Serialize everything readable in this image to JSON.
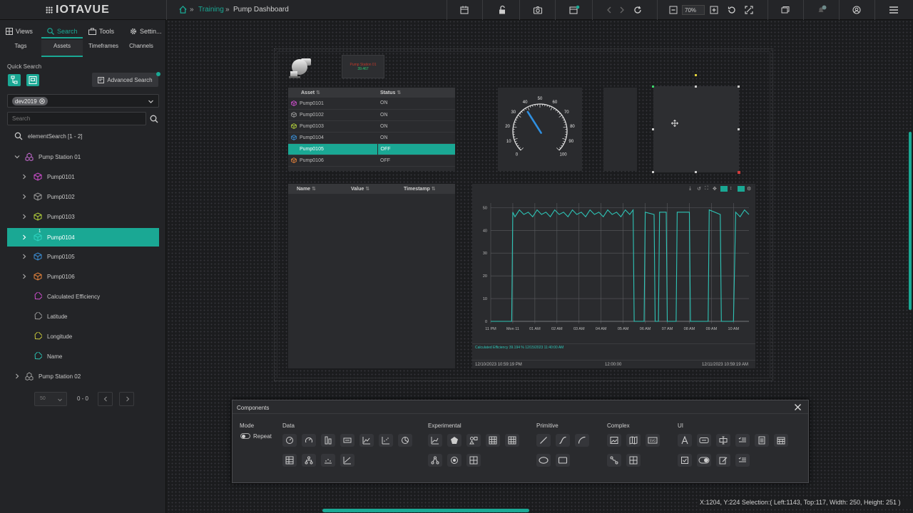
{
  "app": {
    "logo": "IOTAVUE"
  },
  "breadcrumb": {
    "parent": "Training",
    "current": "Pump Dashboard"
  },
  "toolbar": {
    "zoom": "70%"
  },
  "left_tabs": [
    "Views",
    "Search",
    "Tools",
    "Settin..."
  ],
  "sub_tabs": [
    "Tags",
    "Assets",
    "Timeframes",
    "Channels"
  ],
  "quick_search": {
    "label": "Quick Search",
    "advanced": "Advanced Search"
  },
  "datasource": {
    "chip": "dev2019"
  },
  "search": {
    "placeholder": "Search",
    "result": "elementSearch [1 - 2]"
  },
  "tree": [
    {
      "label": "Pump Station 01",
      "color": "#c56bd0"
    },
    {
      "label": "Pump0101",
      "color": "#d14fd1"
    },
    {
      "label": "Pump0102",
      "color": "#9a9a9a"
    },
    {
      "label": "Pump0103",
      "color": "#b5d33b"
    },
    {
      "label": "Pump0104",
      "badge": "1",
      "color": "#1aa894"
    },
    {
      "label": "Pump0105",
      "color": "#3a8fd8"
    },
    {
      "label": "Pump0106",
      "color": "#e8833a"
    },
    {
      "label": "Calculated Efficiency",
      "color": "#d14fd1"
    },
    {
      "label": "Latitude",
      "color": "#9a9a9a"
    },
    {
      "label": "Longitude",
      "color": "#c9c93b"
    },
    {
      "label": "Name",
      "color": "#2bbfb0"
    },
    {
      "label": "Pump Station 02",
      "color": "#9a9a9a"
    }
  ],
  "pager": {
    "size": "50",
    "range": "0 - 0"
  },
  "dashboard": {
    "station_label": "Pump Station 01",
    "station_value": "39.467",
    "asset_table": {
      "headers": [
        "Asset",
        "Status"
      ],
      "rows": [
        {
          "asset": "Pump0101",
          "status": "ON",
          "color": "#d14fd1"
        },
        {
          "asset": "Pump0102",
          "status": "ON",
          "color": "#9a9a9a"
        },
        {
          "asset": "Pump0103",
          "status": "ON",
          "color": "#b5d33b"
        },
        {
          "asset": "Pump0104",
          "status": "ON",
          "color": "#3a8fd8"
        },
        {
          "asset": "Pump0105",
          "status": "OFF",
          "color": "#1aa894"
        },
        {
          "asset": "Pump0106",
          "status": "OFF",
          "color": "#e8833a"
        }
      ]
    },
    "value_table": {
      "headers": [
        "Name",
        "Value",
        "Timestamp"
      ]
    },
    "gauge": {
      "ticks": [
        "0",
        "10",
        "20",
        "30",
        "40",
        "50",
        "60",
        "70",
        "80",
        "90",
        "100"
      ],
      "min": 0,
      "max": 100,
      "value": 38
    }
  },
  "chart_data": {
    "type": "line",
    "y_ticks": [
      "0",
      "10",
      "20",
      "30",
      "40",
      "50"
    ],
    "ylim": [
      0,
      52
    ],
    "x_ticks": [
      "11 PM",
      "Mon 11",
      "01 AM",
      "02 AM",
      "03 AM",
      "04 AM",
      "05 AM",
      "06 AM",
      "07 AM",
      "08 AM",
      "09 AM",
      "10 AM"
    ],
    "series": [
      {
        "name": "Calculated Efficiency",
        "color": "#2ec4b6",
        "x": [
          0,
          0.95,
          1.0,
          1.1,
          1.3,
          1.5,
          1.7,
          1.9,
          2.1,
          2.3,
          2.5,
          2.7,
          2.9,
          3.1,
          3.3,
          3.5,
          3.7,
          3.9,
          4.1,
          4.3,
          4.5,
          4.7,
          4.9,
          5.1,
          5.3,
          5.5,
          5.7,
          5.9,
          6.1,
          6.3,
          6.45,
          6.5,
          6.95,
          7.0,
          7.4,
          7.45,
          7.6,
          7.65,
          7.95,
          8.0,
          8.4,
          8.45,
          9.0,
          9.05,
          9.85,
          9.9,
          10.4,
          10.45,
          11.0,
          11.1,
          11.3,
          11.5,
          11.7
        ],
        "y": [
          0,
          0,
          48,
          46,
          49,
          47,
          48,
          46,
          49,
          47,
          48,
          46,
          49,
          47,
          48,
          46,
          49,
          47,
          48,
          46,
          49,
          47,
          48,
          46,
          49,
          47,
          48,
          46,
          49,
          47,
          49,
          0,
          0,
          48,
          47,
          0,
          0,
          48,
          48,
          0,
          0,
          48,
          48,
          0,
          0,
          49,
          47,
          0,
          0,
          48,
          46,
          49,
          47
        ]
      }
    ],
    "legend": "Calculated Efficiency 39.194 % 12/15/2023 11:40:00 AM",
    "footer": [
      "12/10/2023 10:59:19 PM",
      "12:00:00",
      "12/11/2023 10:59:19 AM"
    ]
  },
  "components": {
    "title": "Components",
    "mode_label": "Mode",
    "repeat_label": "Repeat",
    "groups": [
      "Data",
      "Experimental",
      "Primitive",
      "Complex",
      "UI"
    ]
  },
  "status_bar": "X:1204, Y:224  Selection:( Left:1143, Top:117, Width: 250, Height: 251 )"
}
